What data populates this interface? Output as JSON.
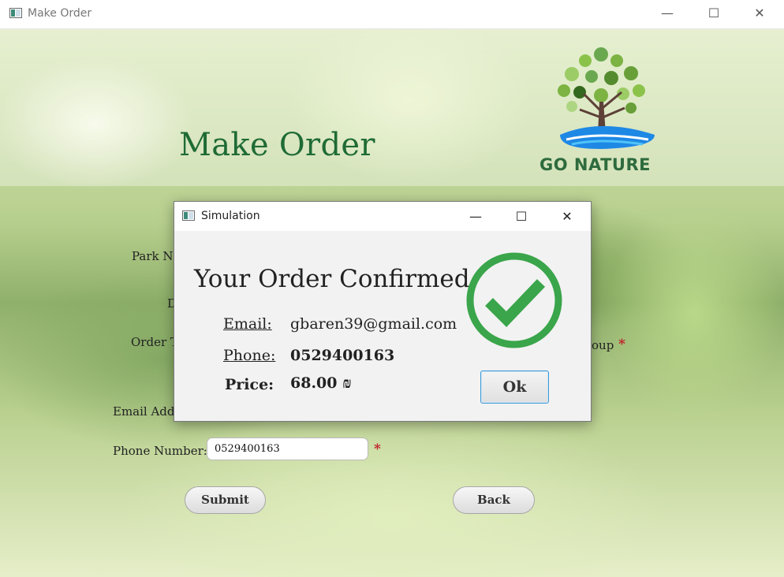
{
  "window": {
    "title": "Make Order",
    "controls": {
      "minimize": "—",
      "maximize": "☐",
      "close": "✕"
    }
  },
  "header": {
    "page_title": "Make Order",
    "logo_text": "GO NATURE"
  },
  "form": {
    "park_name_label": "Park N",
    "date_label": "D",
    "order_type_label": "Order T",
    "group_label_suffix": "oup",
    "email_label": "Email Add",
    "phone_label": "Phone Number:",
    "phone_value": "0529400163",
    "required_mark": "*",
    "submit_label": "Submit",
    "back_label": "Back"
  },
  "dialog": {
    "title": "Simulation",
    "controls": {
      "minimize": "—",
      "maximize": "☐",
      "close": "✕"
    },
    "heading": "Your Order Confirmed",
    "email_label": "Email:",
    "email_value": "gbaren39@gmail.com",
    "phone_label": "Phone:",
    "phone_value": "0529400163",
    "price_label": "Price:",
    "price_value": "68.00 ₪",
    "ok_label": "Ok"
  },
  "colors": {
    "title_green": "#1f6b35",
    "check_green": "#3aa54a",
    "required_red": "#c0202a",
    "ok_border": "#3d9ad6"
  },
  "icons": {
    "app": "app-window-icon",
    "confirm": "check-circle-icon",
    "logo": "tree-logo-icon"
  }
}
